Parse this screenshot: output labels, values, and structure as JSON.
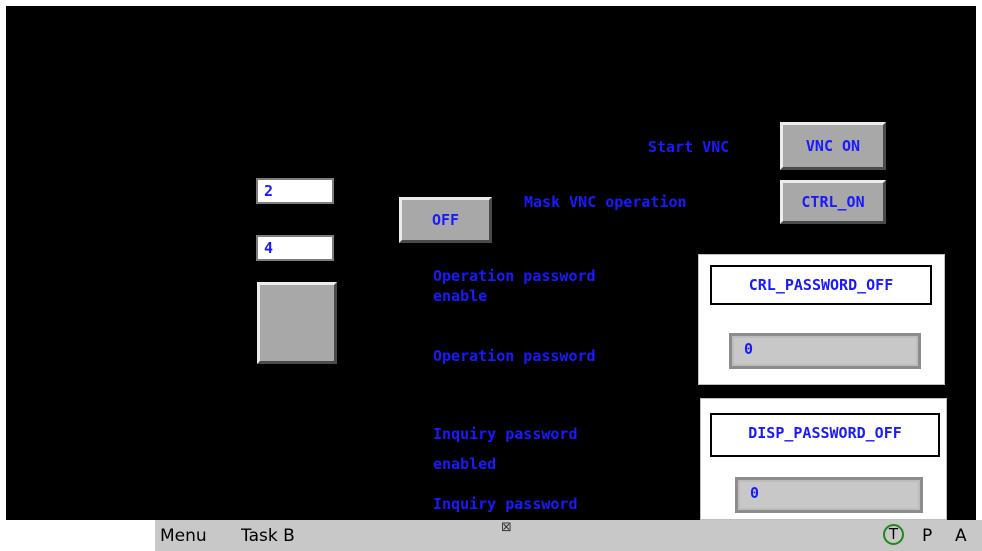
{
  "vnc": {
    "start_label": "Start VNC",
    "start_button": "VNC ON",
    "mask_label": "Mask VNC operation",
    "mask_button": "CTRL_ON"
  },
  "left": {
    "field_top": "2",
    "field_bottom": "4",
    "off_button": "OFF"
  },
  "operation": {
    "enable_label": "Operation password enable",
    "enable_button": "CRL_PASSWORD_OFF",
    "password_label": "Operation password",
    "password_value": "0"
  },
  "inquiry": {
    "enable_label": "Inquiry password enabled",
    "enable_button": "DISP_PASSWORD_OFF",
    "password_label": "Inquiry password",
    "password_value": "0"
  },
  "taskbar": {
    "menu": "Menu",
    "task": "Task B",
    "mid_icon": "⊠",
    "t_icon": "T",
    "p_label": "P",
    "a_label": "A"
  }
}
